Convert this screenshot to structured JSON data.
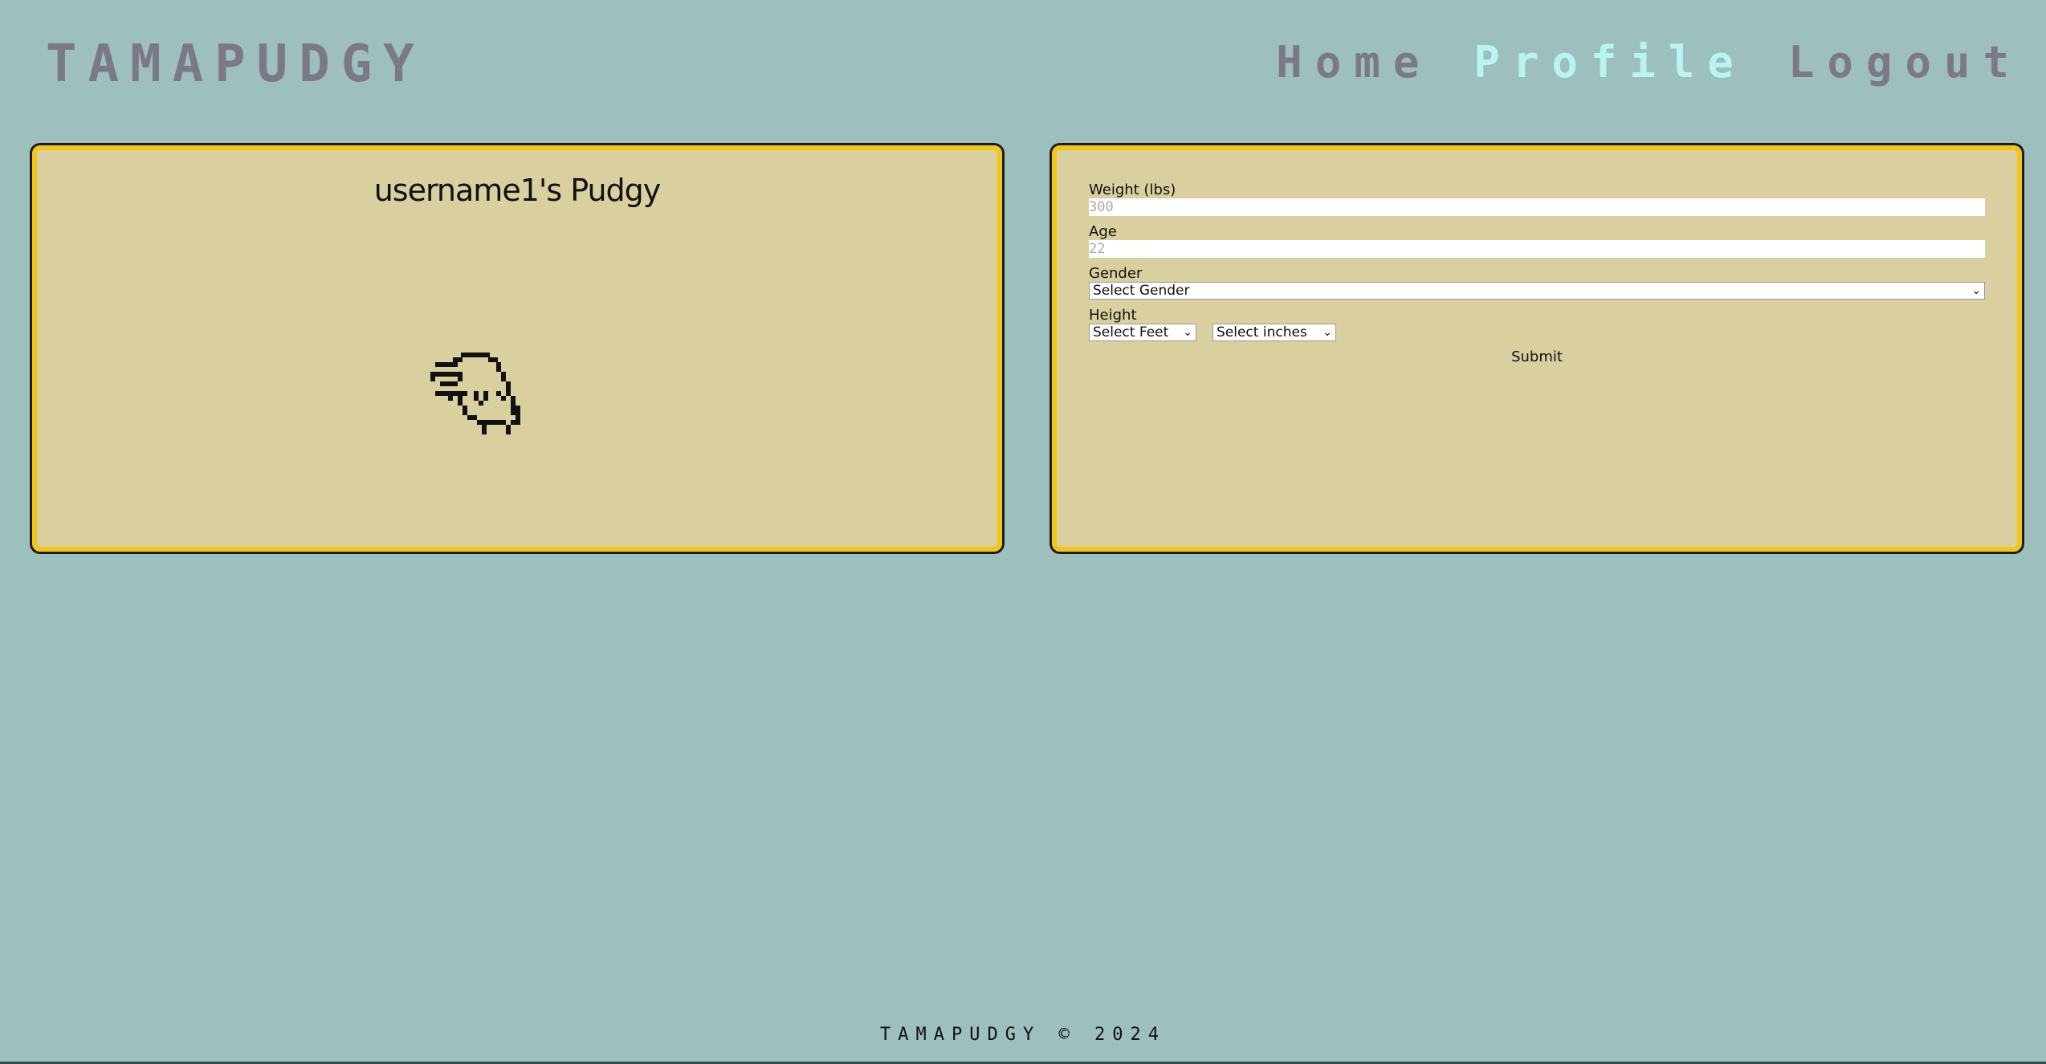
{
  "header": {
    "brand": "TAMAPUDGY",
    "nav": [
      {
        "label": "Home",
        "active": false
      },
      {
        "label": "Profile",
        "active": true
      },
      {
        "label": "Logout",
        "active": false
      }
    ]
  },
  "pet_panel": {
    "title": "username1's Pudgy",
    "sprite": "pixel-pudgy-icon"
  },
  "profile_form": {
    "weight_label": "Weight (lbs)",
    "weight_placeholder": "300",
    "age_label": "Age",
    "age_placeholder": "22",
    "gender_label": "Gender",
    "gender_selected": "Select Gender",
    "height_label": "Height",
    "feet_selected": "Select Feet",
    "inches_selected": "Select inches",
    "submit_label": "Submit"
  },
  "footer": {
    "text": "TAMAPUDGY © 2024"
  },
  "colors": {
    "background": "#9dbfbd",
    "panel_fill": "#dacf9f",
    "panel_border": "#f2c618",
    "nav_active": "#b9f5f0",
    "nav_inactive": "#7b7985"
  }
}
